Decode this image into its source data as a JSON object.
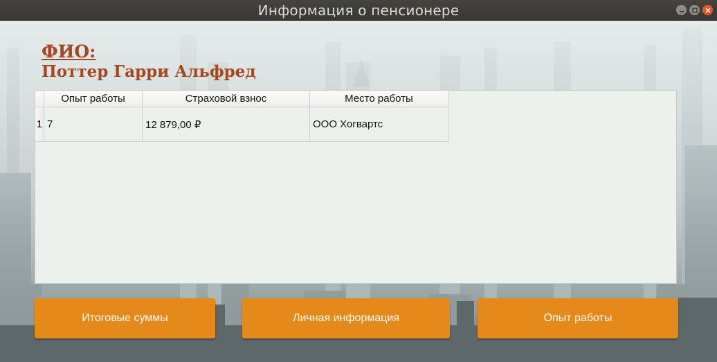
{
  "window": {
    "title": "Информация о пенсионере"
  },
  "header": {
    "fio_label": "ФИО:",
    "fio_value": "Поттер Гарри Альфред"
  },
  "table": {
    "columns": [
      "Опыт работы",
      "Страховой взнос",
      "Место работы"
    ],
    "rows": [
      {
        "index": "1",
        "cells": [
          "7",
          "12 879,00 ₽",
          "ООО Хогвартс"
        ]
      }
    ]
  },
  "buttons": {
    "totals": "Итоговые суммы",
    "personal": "Личная информация",
    "experience": "Опыт работы"
  },
  "colors": {
    "accent_button": "#e5891a",
    "header_text": "#a8461f",
    "close_button": "#e9541f"
  }
}
